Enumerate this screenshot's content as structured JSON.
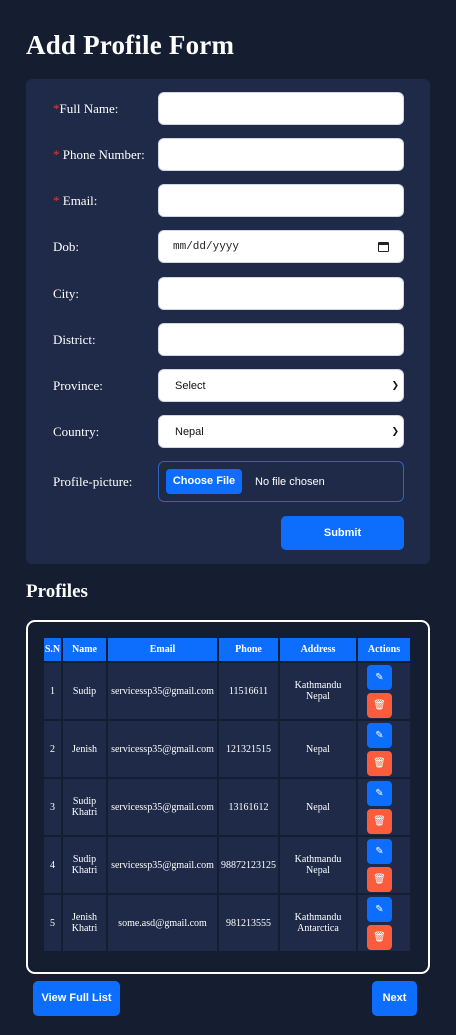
{
  "page": {
    "title": "Add Profile Form"
  },
  "form": {
    "fields": [
      {
        "id": "full-name",
        "required": "*",
        "label": "Full Name:",
        "type": "text",
        "value": ""
      },
      {
        "id": "phone-number",
        "required": "*",
        "label": " Phone Number:",
        "type": "text",
        "value": ""
      },
      {
        "id": "email",
        "required": "*",
        "label": " Email:",
        "type": "text",
        "value": ""
      },
      {
        "id": "dob",
        "required": "",
        "label": "Dob:",
        "type": "date",
        "value": "mm/dd/yyyy"
      },
      {
        "id": "city",
        "required": "",
        "label": "City:",
        "type": "text",
        "value": ""
      },
      {
        "id": "district",
        "required": "",
        "label": "District:",
        "type": "text",
        "value": ""
      },
      {
        "id": "province",
        "required": "",
        "label": "Province:",
        "type": "select",
        "value": "Select"
      },
      {
        "id": "country",
        "required": "",
        "label": "Country:",
        "type": "select",
        "value": "Nepal"
      }
    ],
    "profile_picture": {
      "label": "Profile-picture:",
      "button": "Choose File",
      "status": "No file chosen"
    },
    "submit_label": "Submit"
  },
  "profiles": {
    "title": "Profiles",
    "headers": [
      "S.N",
      "Name",
      "Email",
      "Phone",
      "Address",
      "Actions"
    ],
    "rows": [
      {
        "sn": "1",
        "name": "Sudip",
        "email": "servicessp35@gmail.com",
        "phone": "11516611",
        "address": [
          "Kathmandu",
          "Nepal"
        ]
      },
      {
        "sn": "2",
        "name": "Jenish",
        "email": "servicessp35@gmail.com",
        "phone": "121321515",
        "address": [
          "Nepal"
        ]
      },
      {
        "sn": "3",
        "name": "Sudip Khatri",
        "email": "servicessp35@gmail.com",
        "phone": "13161612",
        "address": [
          "Nepal"
        ]
      },
      {
        "sn": "4",
        "name": "Sudip Khatri",
        "email": "servicessp35@gmail.com",
        "phone": "98872123125",
        "address": [
          "Kathmandu",
          "Nepal"
        ]
      },
      {
        "sn": "5",
        "name": "Jenish Khatri",
        "email": "some.asd@gmail.com",
        "phone": "981213555",
        "address": [
          "Kathmandu",
          "Antarctica"
        ]
      }
    ]
  },
  "footer": {
    "view_full_list": "View Full List",
    "next": "Next"
  },
  "icons": {
    "edit": "edit-icon",
    "delete": "trash-icon",
    "dropdown": "chevron-down-icon",
    "calendar": "calendar-icon"
  },
  "colors": {
    "background": "#151e30",
    "card": "#1e2a47",
    "primary": "#0d6efd",
    "danger": "#fa5c3c",
    "required": "#e53935"
  }
}
